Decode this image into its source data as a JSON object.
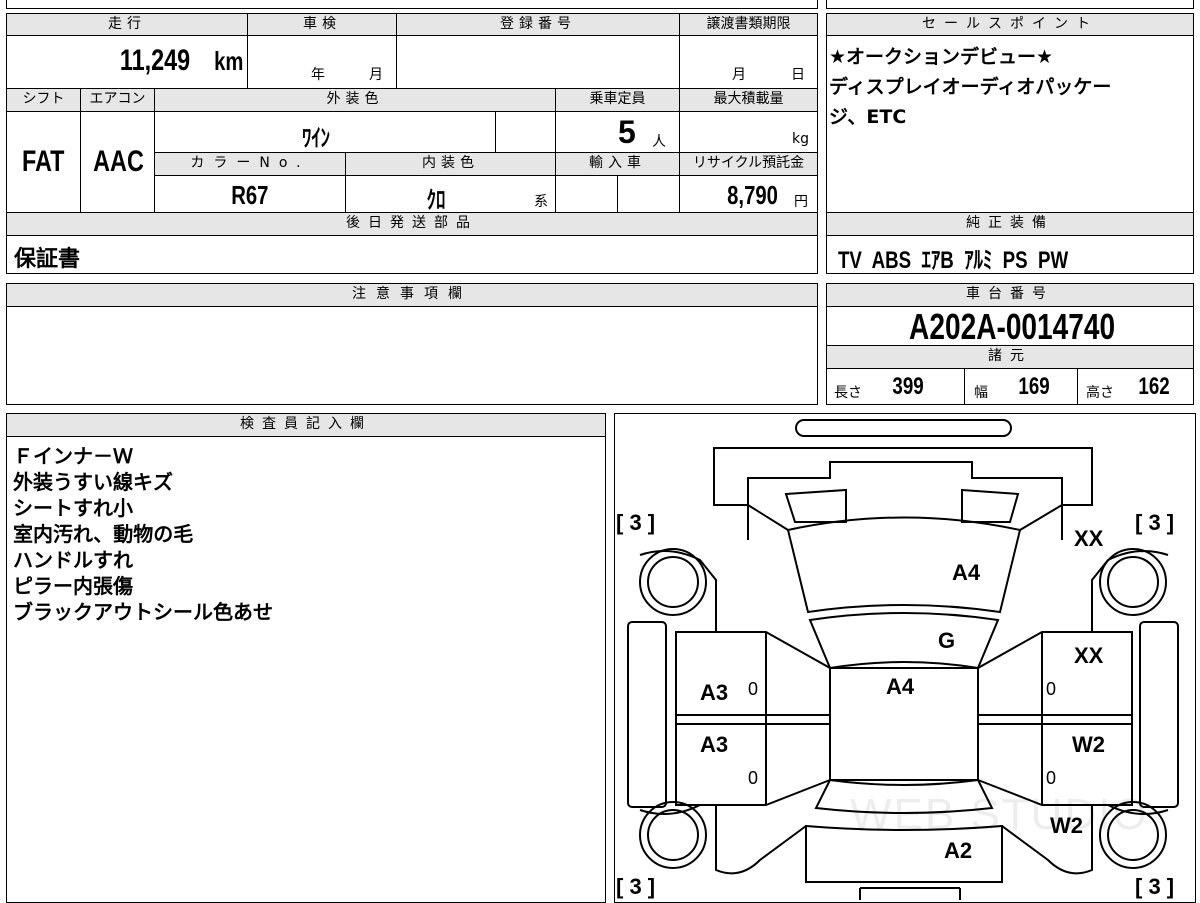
{
  "top_left": {
    "headers": {
      "mileage": "走行",
      "inspection": "車検",
      "registration": "登録番号",
      "transfer_deadline": "譲渡書類期限"
    },
    "mileage_value": "11,249",
    "mileage_unit": "km",
    "inspection_year": "年",
    "inspection_month": "月",
    "transfer_month": "月",
    "transfer_day": "日",
    "headers2": {
      "shift": "シフト",
      "aircon": "エアコン",
      "exterior_color": "外装色",
      "capacity": "乗車定員",
      "max_load": "最大積載量"
    },
    "shift_value": "FAT",
    "aircon_value": "AAC",
    "exterior_color_value": "ﾜｲﾝ",
    "capacity_value": "5",
    "capacity_unit": "人",
    "max_load_unit": "kg",
    "headers3": {
      "color_no": "カラーNo.",
      "interior_color": "内装色",
      "import": "輸入車",
      "recycle": "リサイクル預託金"
    },
    "color_no_value": "R67",
    "interior_color_value": "ｸﾛ",
    "interior_color_suffix": "系",
    "recycle_value": "8,790",
    "recycle_unit": "円",
    "later_parts_header": "後日発送部品",
    "later_parts_value": "保証書"
  },
  "sales_points": {
    "header": "セールスポイント",
    "lines": [
      "★オークションデビュー★",
      "ディスプレイオーディオパッケー",
      "ジ、ETC"
    ]
  },
  "standard_equipment": {
    "header": "純正装備",
    "value": "TV  ABS  ｴｱB  ｱﾙﾐ  PS  PW"
  },
  "caution": {
    "header": "注意事項欄"
  },
  "chassis": {
    "header": "車台番号",
    "value": "A202A-0014740"
  },
  "specs": {
    "header": "諸元",
    "length_label": "長さ",
    "length_value": "399",
    "width_label": "幅",
    "width_value": "169",
    "height_label": "高さ",
    "height_value": "162"
  },
  "inspector": {
    "header": "検査員記入欄",
    "notes": [
      "Ｆインナ－Ｗ",
      "外装うすい線キズ",
      "シートすれ小",
      "室内汚れ、動物の毛",
      "ハンドルすれ",
      "ピラー内張傷",
      "ブラックアウトシール色あせ"
    ]
  },
  "diagram": {
    "watermark": "WEB STUDIO",
    "tire_tl": "[ 3 ]",
    "tire_tr": "[ 3 ]",
    "tire_bl": "[ 3 ]",
    "tire_br": "[ 3 ]",
    "hood": "A4",
    "windshield": "G",
    "roof": "A4",
    "left_front_door": "A3",
    "left_rear_door": "A3",
    "left_front_door_small": "0",
    "left_rear_door_small": "0",
    "right_front_fender": "XX",
    "right_front_door": "XX",
    "right_rear_door": "W2",
    "right_rear_fender": "W2",
    "right_front_door_small": "0",
    "right_rear_door_small": "0",
    "rear": "A2"
  }
}
